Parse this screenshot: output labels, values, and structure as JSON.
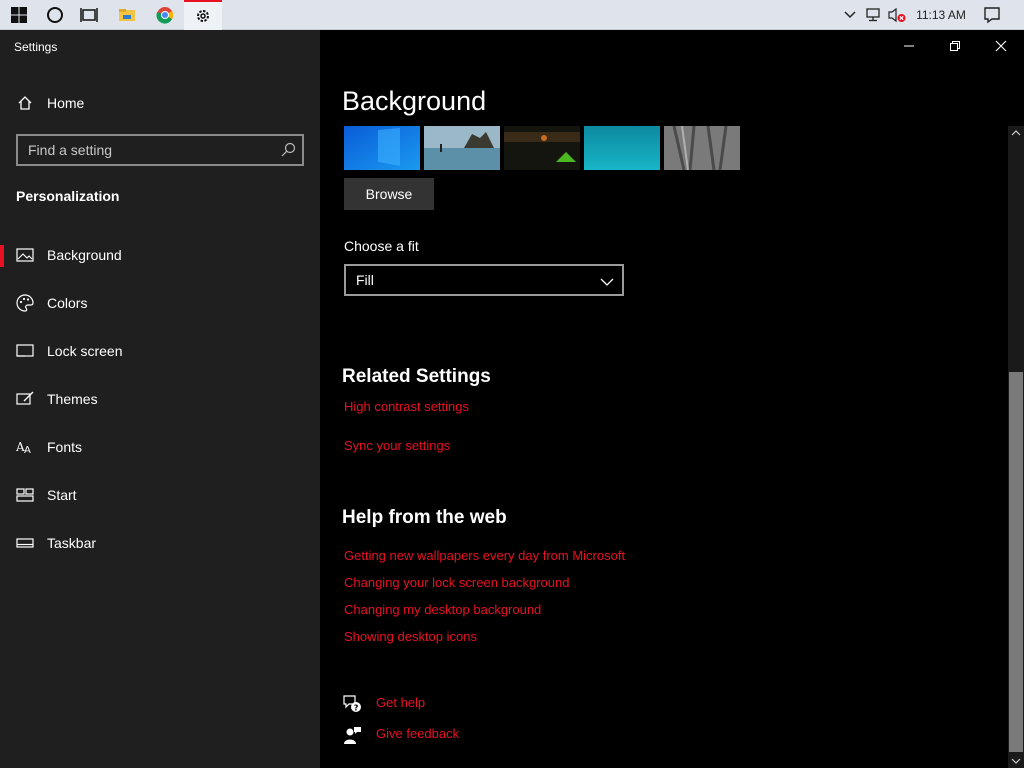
{
  "taskbar": {
    "icons": [
      "windows-start-icon",
      "cortana-icon",
      "task-view-icon",
      "file-explorer-icon",
      "chrome-icon",
      "settings-icon"
    ],
    "clock": "11:13 AM"
  },
  "sidebar": {
    "app_title": "Settings",
    "home_label": "Home",
    "search_placeholder": "Find a setting",
    "section_heading": "Personalization",
    "items": [
      {
        "label": "Background",
        "icon": "picture-icon"
      },
      {
        "label": "Colors",
        "icon": "palette-icon"
      },
      {
        "label": "Lock screen",
        "icon": "lock-screen-icon"
      },
      {
        "label": "Themes",
        "icon": "themes-icon"
      },
      {
        "label": "Fonts",
        "icon": "fonts-icon"
      },
      {
        "label": "Start",
        "icon": "start-icon"
      },
      {
        "label": "Taskbar",
        "icon": "taskbar-icon"
      }
    ],
    "selected": "Background"
  },
  "main": {
    "title": "Background",
    "browse_label": "Browse",
    "fit_label": "Choose a fit",
    "fit_value": "Fill",
    "related_heading": "Related Settings",
    "related_links": [
      "High contrast settings",
      "Sync your settings"
    ],
    "help_heading": "Help from the web",
    "help_links": [
      "Getting new wallpapers every day from Microsoft",
      "Changing your lock screen background",
      "Changing my desktop background",
      "Showing desktop icons"
    ],
    "get_help": "Get help",
    "give_feedback": "Give feedback"
  },
  "colors": {
    "accent": "#e81123",
    "sidebar_bg": "#1f1f1f",
    "content_bg": "#000000",
    "taskbar_bg": "#dfe4ec"
  }
}
